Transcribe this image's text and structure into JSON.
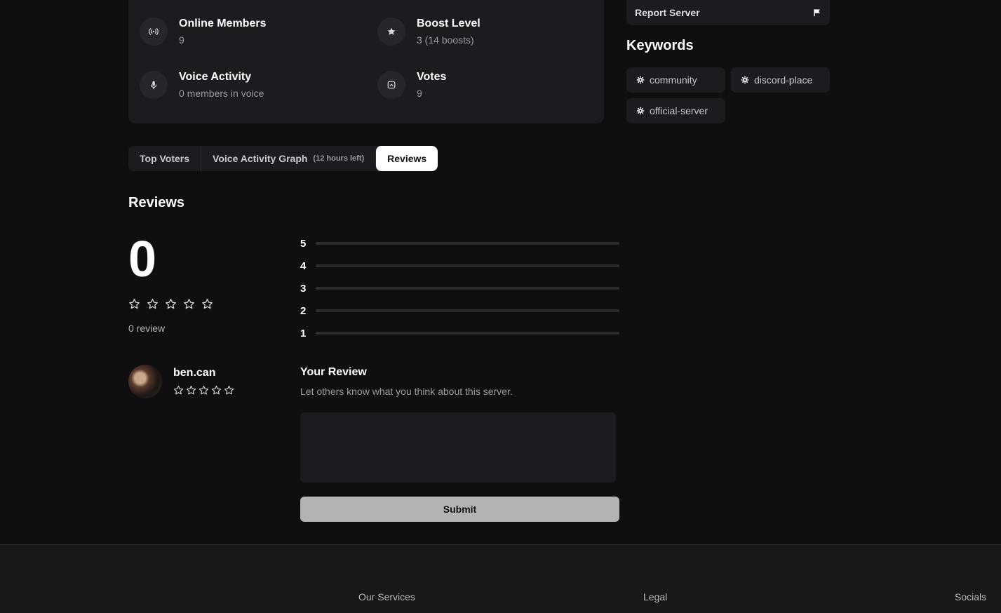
{
  "stats": [
    {
      "title": "Online Members",
      "value": "9",
      "icon": "broadcast-icon"
    },
    {
      "title": "Boost Level",
      "value": "3 (14 boosts)",
      "icon": "star-icon"
    },
    {
      "title": "Voice Activity",
      "value": "0 members in voice",
      "icon": "microphone-icon"
    },
    {
      "title": "Votes",
      "value": "9",
      "icon": "vote-icon"
    }
  ],
  "report": {
    "label": "Report Server",
    "icon": "flag-icon"
  },
  "keywords": {
    "title": "Keywords",
    "items": [
      "community",
      "discord-place",
      "official-server"
    ],
    "icon": "gear-icon"
  },
  "tabs": [
    {
      "label": "Top Voters"
    },
    {
      "label": "Voice Activity Graph",
      "sub": "(12 hours left)"
    },
    {
      "label": "Reviews",
      "active": true
    }
  ],
  "reviews": {
    "title": "Reviews",
    "average": "0",
    "rating_stars": 0,
    "count_text": "0 review",
    "distribution": [
      {
        "stars": "5",
        "count": 0
      },
      {
        "stars": "4",
        "count": 0
      },
      {
        "stars": "3",
        "count": 0
      },
      {
        "stars": "2",
        "count": 0
      },
      {
        "stars": "1",
        "count": 0
      }
    ]
  },
  "user": {
    "name": "ben.can",
    "rating": 0
  },
  "your_review": {
    "title": "Your Review",
    "subtitle": "Let others know what you think about this server.",
    "placeholder": "",
    "submit_label": "Submit"
  },
  "footer": {
    "columns": [
      "Our Services",
      "Legal",
      "Socials"
    ]
  },
  "colors": {
    "background": "#0f0f11",
    "card": "#1b1b20",
    "submit": "#b3b3b3"
  }
}
